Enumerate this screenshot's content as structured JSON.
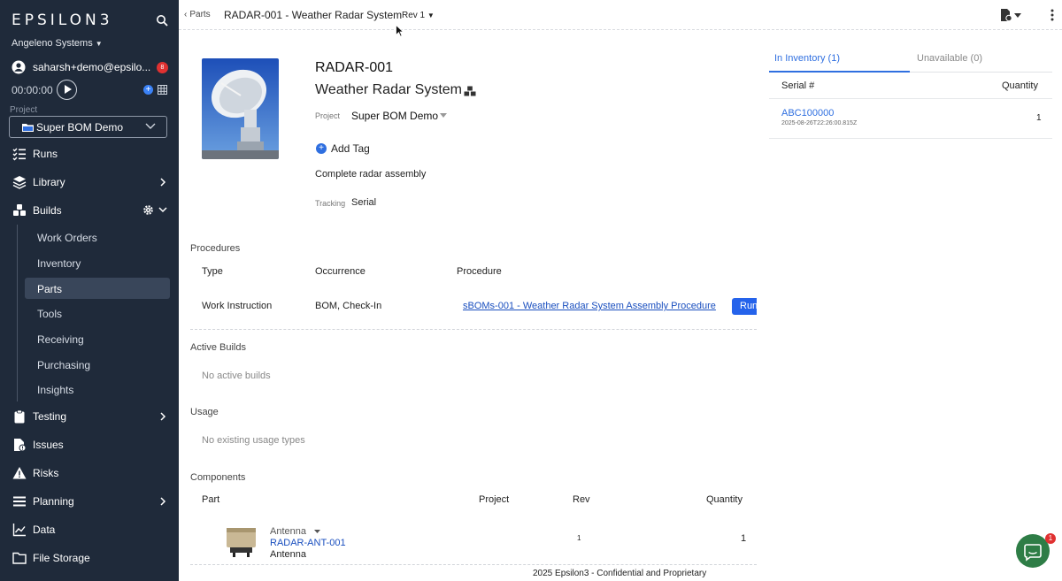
{
  "sidebar": {
    "logo": "EPSILON3",
    "org": "Angeleno Systems",
    "user_email": "saharsh+demo@epsilo...",
    "notification_count": "8",
    "timer": "00:00:00",
    "project_label": "Project",
    "project_value": "Super BOM Demo",
    "nav": {
      "runs": "Runs",
      "library": "Library",
      "builds": "Builds",
      "testing": "Testing",
      "issues": "Issues",
      "risks": "Risks",
      "planning": "Planning",
      "data": "Data",
      "file_storage": "File Storage"
    },
    "builds_sub": [
      "Work Orders",
      "Inventory",
      "Parts",
      "Tools",
      "Receiving",
      "Purchasing",
      "Insights"
    ]
  },
  "topbar": {
    "breadcrumb": "Parts",
    "title": "RADAR-001 - Weather Radar System",
    "rev": "Rev 1"
  },
  "part": {
    "part_number": "RADAR-001",
    "name": "Weather Radar System",
    "project_label": "Project",
    "project_value": "Super BOM Demo",
    "add_tag": "Add Tag",
    "description": "Complete radar assembly",
    "tracking_label": "Tracking",
    "tracking_value": "Serial"
  },
  "procedures": {
    "title": "Procedures",
    "headers": [
      "Type",
      "Occurrence",
      "Procedure"
    ],
    "row": {
      "type": "Work Instruction",
      "occurrence": "BOM, Check-In",
      "procedure": "sBOMs-001 - Weather Radar System Assembly Procedure",
      "run_label": "Run"
    }
  },
  "active_builds": {
    "title": "Active Builds",
    "empty": "No active builds"
  },
  "usage": {
    "title": "Usage",
    "empty": "No existing usage types"
  },
  "components": {
    "title": "Components",
    "headers": [
      "Part",
      "Project",
      "Rev",
      "Quantity"
    ],
    "row": {
      "name": "Antenna",
      "part_number": "RADAR-ANT-001",
      "description": "Antenna",
      "rev": "1",
      "quantity": "1"
    }
  },
  "footer": "2025 Epsilon3 - Confidential and Proprietary",
  "inventory": {
    "tab_in": "In Inventory (1)",
    "tab_unavailable": "Unavailable (0)",
    "headers": [
      "Serial #",
      "Quantity"
    ],
    "row": {
      "serial": "ABC100000",
      "date": "2025-08-26T22:26:00.815Z",
      "quantity": "1"
    }
  },
  "chat_badge": "1",
  "colors": {
    "sidebar_bg": "#1f2a3a",
    "accent": "#2563eb",
    "link": "#1a4fbf",
    "badge": "#e03131"
  }
}
